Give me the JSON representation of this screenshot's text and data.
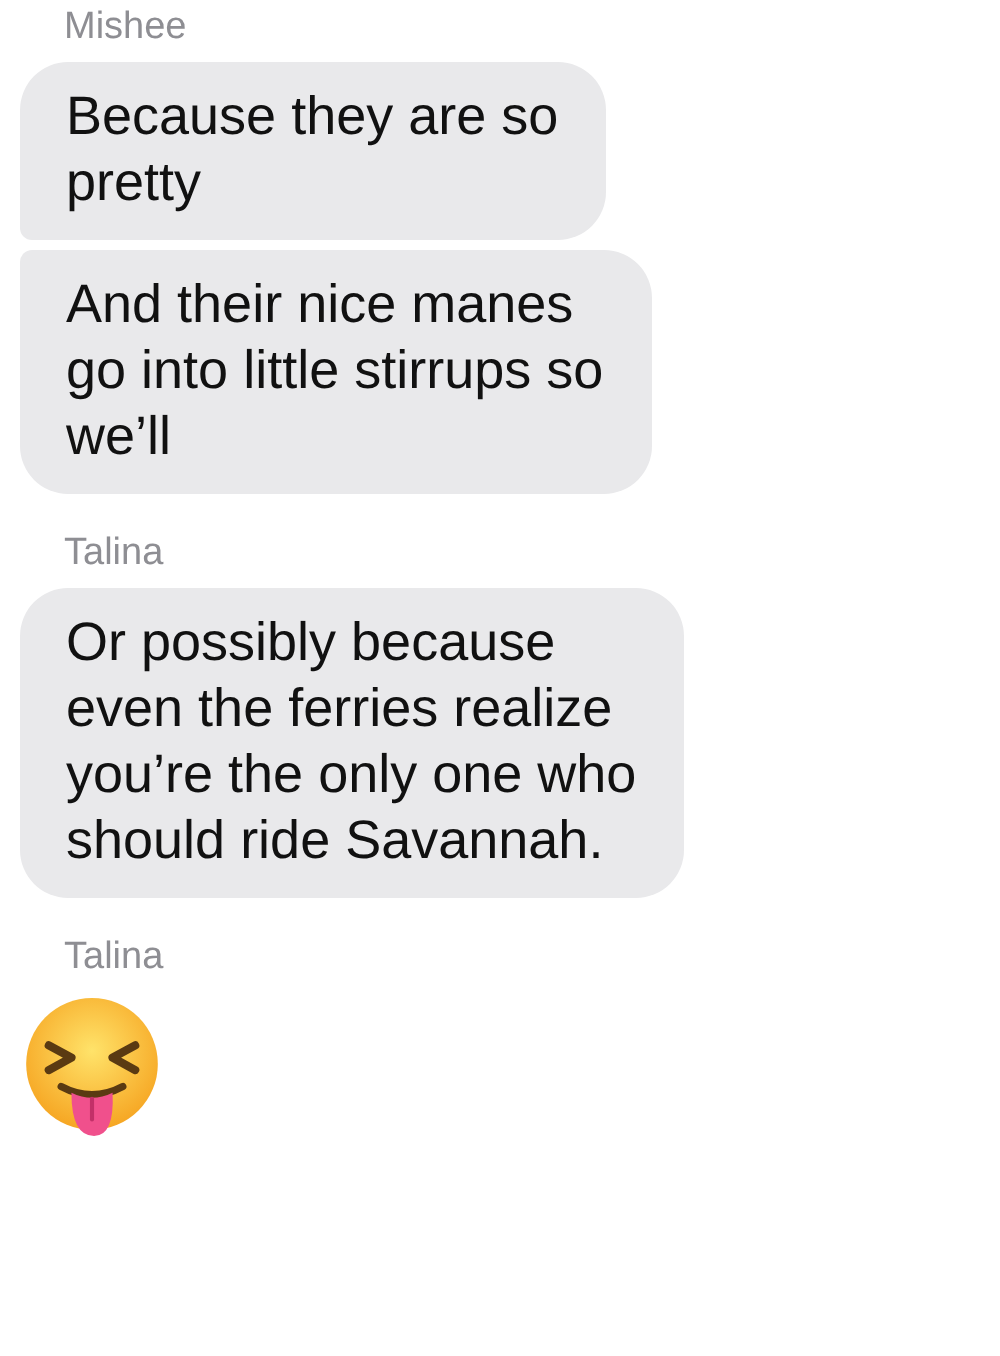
{
  "groups": [
    {
      "sender": "Mishee",
      "messages": [
        {
          "kind": "text",
          "text": "Because they are so\npretty"
        },
        {
          "kind": "text",
          "text": "And their nice manes\ngo into little stirrups so\nwe’ll"
        }
      ]
    },
    {
      "sender": "Talina",
      "messages": [
        {
          "kind": "text",
          "text": "Or possibly because\neven the ferries realize\nyou’re the only one who\nshould ride Savannah."
        }
      ]
    },
    {
      "sender": "Talina",
      "messages": [
        {
          "kind": "emoji"
        }
      ]
    }
  ]
}
